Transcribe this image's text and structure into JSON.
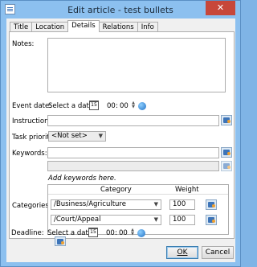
{
  "window": {
    "title": "Edit article - test bullets",
    "close_glyph": "✕"
  },
  "tabs": [
    "Title",
    "Location",
    "Details",
    "Relations",
    "Info"
  ],
  "active_tab": "Details",
  "fields": {
    "notes_label": "Notes:",
    "event_date_label": "Event date:",
    "instructions_label": "Instructions:",
    "priority_label": "Task priority:",
    "keywords_label": "Keywords:",
    "categories_label": "Categories:",
    "deadline_label": "Deadline:"
  },
  "date_picker": {
    "placeholder": "Select a date",
    "calendar_day": "15",
    "hours": "00",
    "minutes": "00",
    "separator": ":"
  },
  "priority": {
    "selected": "<Not set>"
  },
  "keywords": {
    "add_hint": "Add keywords here."
  },
  "categories": {
    "columns": [
      "Category",
      "Weight"
    ],
    "rows": [
      {
        "category": "/Business/Agriculture",
        "weight": "100"
      },
      {
        "category": "/Court/Appeal",
        "weight": "100"
      }
    ]
  },
  "buttons": {
    "ok": "OK",
    "cancel": "Cancel"
  },
  "icons": [
    "calendar-icon",
    "globe-icon",
    "browse-icon",
    "close-icon",
    "spin-icon"
  ],
  "colors": {
    "titlebar": "#8cc0ef",
    "close": "#c7473a",
    "panel": "#f0f0f0"
  }
}
